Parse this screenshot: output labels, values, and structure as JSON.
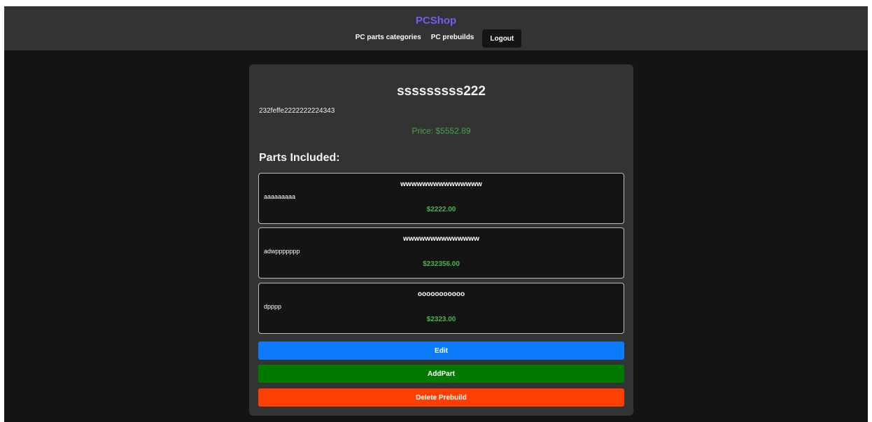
{
  "navbar": {
    "brand": "PCShop",
    "links": [
      "PC parts categories",
      "PC prebuilds"
    ],
    "logout_label": "Logout"
  },
  "prebuild": {
    "name": "sssssssss222",
    "description": "232feffe2222222224343",
    "price": "Price: $5552.89"
  },
  "parts_heading": "Parts Included:",
  "parts": [
    {
      "name": "wwwwwwwwwwwwwww",
      "description": "aaaaaaaaa",
      "price": "$2222.00"
    },
    {
      "name": "wwwwwwwwwwwwww",
      "description": "adwppppppp",
      "price": "$232356.00"
    },
    {
      "name": "ooooooooooo",
      "description": "dpppp",
      "price": "$2323.00"
    }
  ],
  "actions": {
    "edit_label": "Edit",
    "add_part_label": "AddPart",
    "delete_label": "Delete Prebuild"
  },
  "colors": {
    "brand": "#6f5ff2",
    "price": "#48a34c",
    "edit": "#0d7bfb",
    "add_part": "#027a02",
    "delete": "#fd3f02"
  }
}
